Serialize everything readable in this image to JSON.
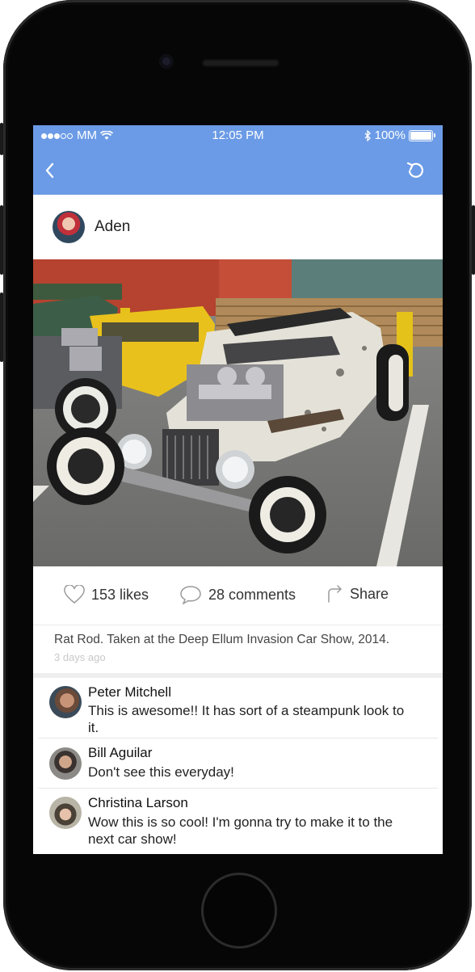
{
  "status": {
    "carrier": "MM",
    "time": "12:05 PM",
    "battery": "100%",
    "signal_bars": 3,
    "signal_total": 5
  },
  "nav": {
    "back_icon": "chevron-left-icon",
    "refresh_icon": "refresh-icon"
  },
  "post": {
    "author": "Aden",
    "caption": "Rat Rod. Taken at the Deep Ellum Invasion Car Show, 2014.",
    "time_ago": "3 days ago"
  },
  "actions": {
    "likes": "153 likes",
    "comments": "28 comments",
    "share": "Share"
  },
  "comments": [
    {
      "name": "Peter Mitchell",
      "text": "This is awesome!! It has sort of a steampunk look to it."
    },
    {
      "name": "Bill Aguilar",
      "text": "Don't see this everyday!"
    },
    {
      "name": "Christina Larson",
      "text": "Wow this is so cool! I'm gonna try to make it to the next car show!"
    }
  ],
  "colors": {
    "accent": "#6b9be6"
  }
}
